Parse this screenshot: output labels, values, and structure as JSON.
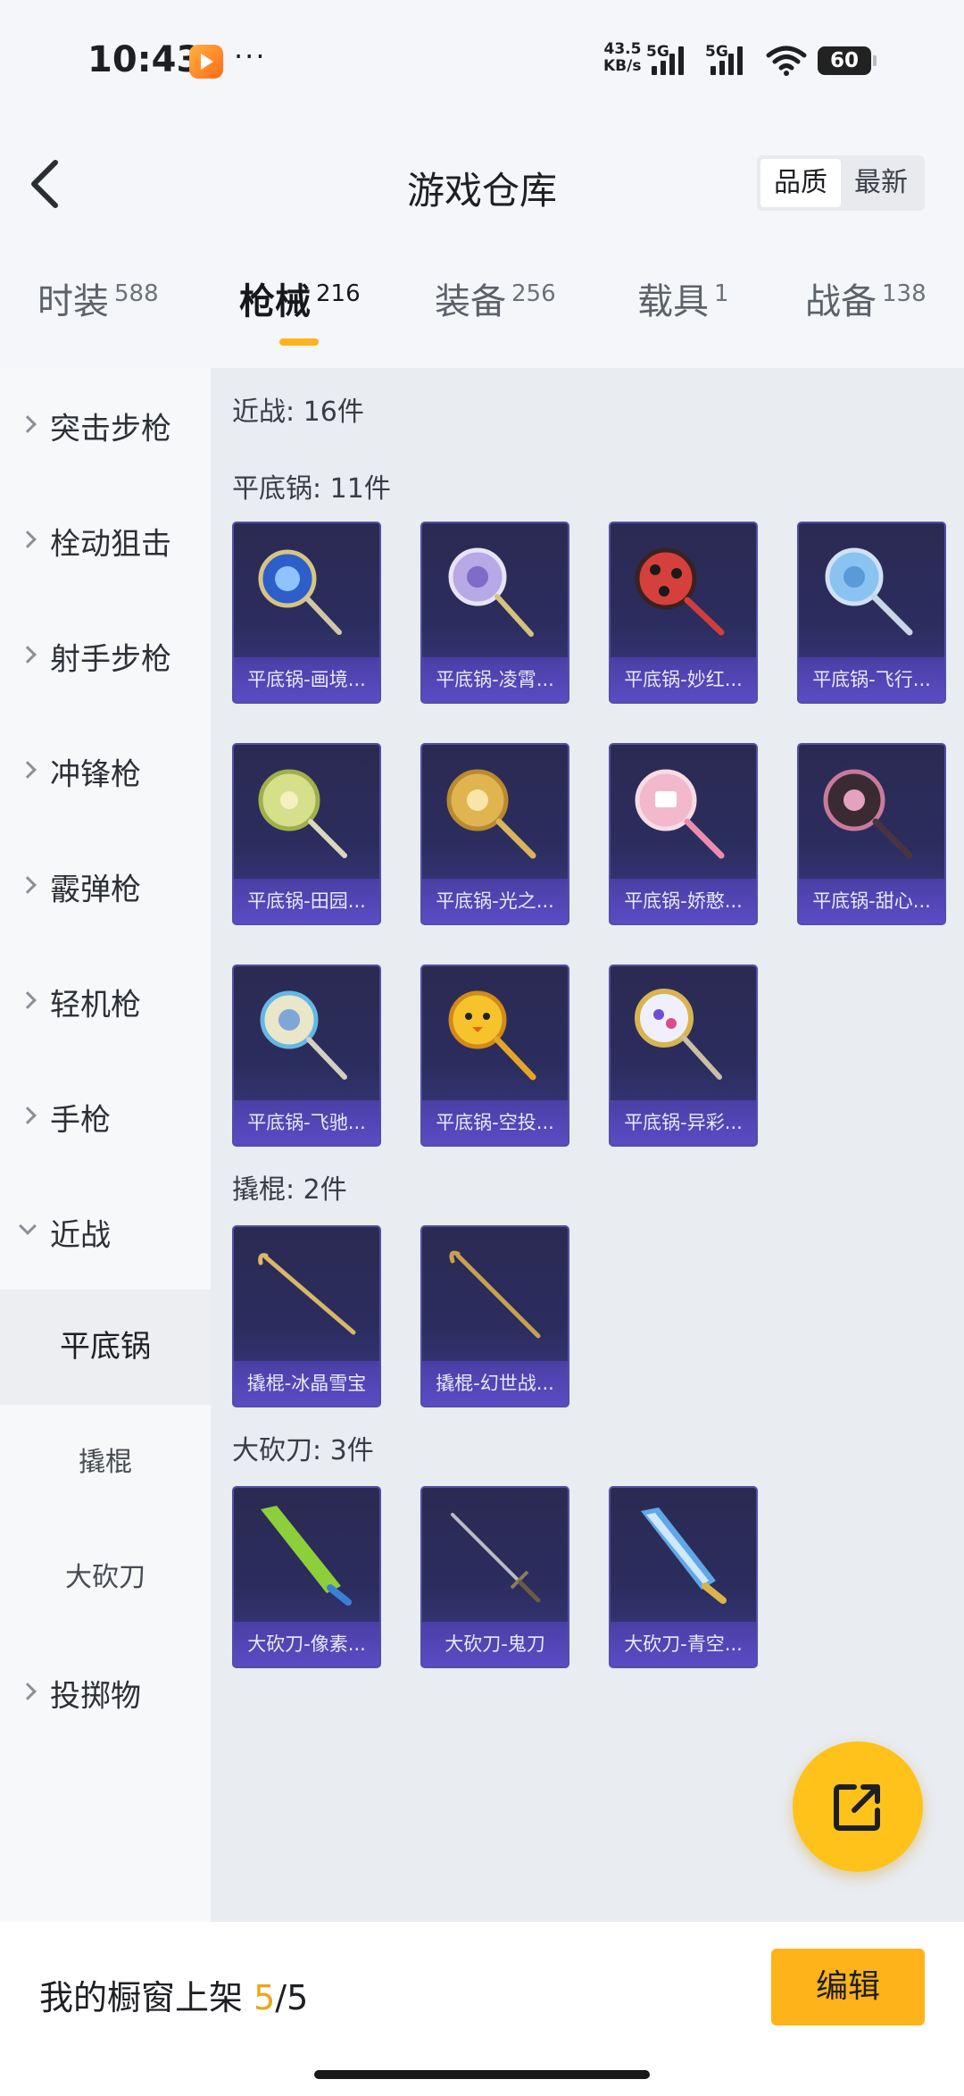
{
  "status_bar": {
    "time": "10:43",
    "dots": "···",
    "speed_value": "43.5",
    "speed_unit": "KB/s",
    "net1": "5G",
    "net2": "5G",
    "battery": "60"
  },
  "header": {
    "title": "游戏仓库",
    "sort_options": [
      "品质",
      "最新"
    ]
  },
  "tabs": [
    {
      "label": "时装",
      "count": "588"
    },
    {
      "label": "枪械",
      "count": "216"
    },
    {
      "label": "装备",
      "count": "256"
    },
    {
      "label": "载具",
      "count": "1"
    },
    {
      "label": "战备",
      "count": "138"
    }
  ],
  "sidebar": {
    "items": [
      "突击步枪",
      "栓动狙击",
      "射手步枪",
      "冲锋枪",
      "霰弹枪",
      "轻机枪",
      "手枪",
      "近战"
    ],
    "sub_items": [
      "平底锅",
      "撬棍",
      "大砍刀"
    ],
    "last_item": "投掷物"
  },
  "main": {
    "group_title": "近战: 16件",
    "sections": [
      {
        "title": "平底锅: 11件",
        "items": [
          "平底锅-画境...",
          "平底锅-凌霄...",
          "平底锅-妙红...",
          "平底锅-飞行...",
          "平底锅-田园...",
          "平底锅-光之...",
          "平底锅-娇憨...",
          "平底锅-甜心...",
          "平底锅-飞驰...",
          "平底锅-空投...",
          "平底锅-异彩..."
        ]
      },
      {
        "title": "撬棍: 2件",
        "items": [
          "撬棍-冰晶雪宝",
          "撬棍-幻世战..."
        ]
      },
      {
        "title": "大砍刀: 3件",
        "items": [
          "大砍刀-像素...",
          "大砍刀-鬼刀",
          "大砍刀-青空..."
        ]
      }
    ]
  },
  "bottom": {
    "showcase_label": "我的橱窗上架",
    "showcase_current": "5",
    "showcase_total": "/5",
    "edit_label": "编辑"
  },
  "colors": {
    "accent": "#ffb31a",
    "card_bg": "#2b2d5e",
    "card_label_bg": "#5c4bc5"
  }
}
